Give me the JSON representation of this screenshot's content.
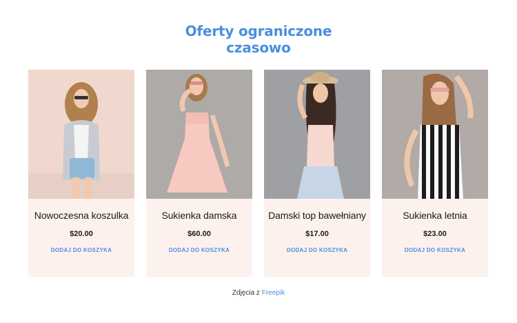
{
  "section": {
    "title_line1": "Oferty ograniczone",
    "title_line2": "czasowo"
  },
  "products": [
    {
      "name": "Nowoczesna koszulka",
      "price": "$20.00",
      "cart_label": "DODAJ DO KOSZYKA"
    },
    {
      "name": "Sukienka damska",
      "price": "$60.00",
      "cart_label": "DODAJ DO KOSZYKA"
    },
    {
      "name": "Damski top bawełniany",
      "price": "$17.00",
      "cart_label": "DODAJ DO KOSZYKA"
    },
    {
      "name": "Sukienka letnia",
      "price": "$23.00",
      "cart_label": "DODAJ DO KOSZYKA"
    }
  ],
  "credit": {
    "text": "Zdjęcia z",
    "link_label": "Freepik"
  },
  "colors": {
    "accent": "#4a8fdc",
    "card_background": "#fdf1ee",
    "text": "#1a1a1a"
  }
}
